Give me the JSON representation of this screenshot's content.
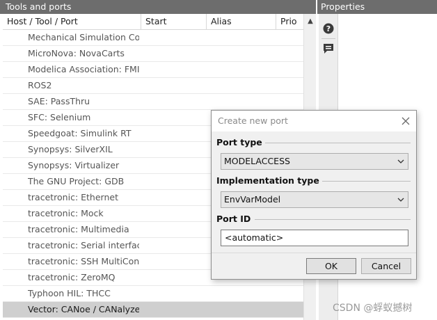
{
  "left_panel": {
    "title": "Tools and ports",
    "columns": [
      "Host / Tool / Port",
      "Start",
      "Alias",
      "Prio"
    ],
    "rows": [
      "Mechanical Simulation Co...",
      "MicroNova: NovaCarts",
      "Modelica Association: FMI",
      "ROS2",
      "SAE: PassThru",
      "SFC: Selenium",
      "Speedgoat: Simulink RT",
      "Synopsys: SilverXIL",
      "Synopsys: Virtualizer",
      "The GNU Project: GDB",
      "tracetronic: Ethernet",
      "tracetronic: Mock",
      "tracetronic: Multimedia",
      "tracetronic: Serial interface",
      "tracetronic: SSH MultiCon...",
      "tracetronic: ZeroMQ",
      "Typhoon HIL: THCC",
      "Vector: CANoe / CANalyzer"
    ],
    "selected_row": "Vector: CANoe / CANalyzer"
  },
  "right_panel": {
    "title": "Properties",
    "toolbar_icons": [
      "help-icon",
      "comment-icon"
    ]
  },
  "dialog": {
    "title": "Create new port",
    "port_type_label": "Port type",
    "port_type_value": "MODELACCESS",
    "impl_type_label": "Implementation type",
    "impl_type_value": "EnvVarModel",
    "port_id_label": "Port ID",
    "port_id_value": "<automatic>",
    "ok_label": "OK",
    "cancel_label": "Cancel"
  },
  "watermark": "CSDN @蜉蚁撼树",
  "colors": {
    "panel_header": "#6d6d6d",
    "selected_row": "#cfcfcf",
    "dialog_bg": "#f0f0f0"
  }
}
